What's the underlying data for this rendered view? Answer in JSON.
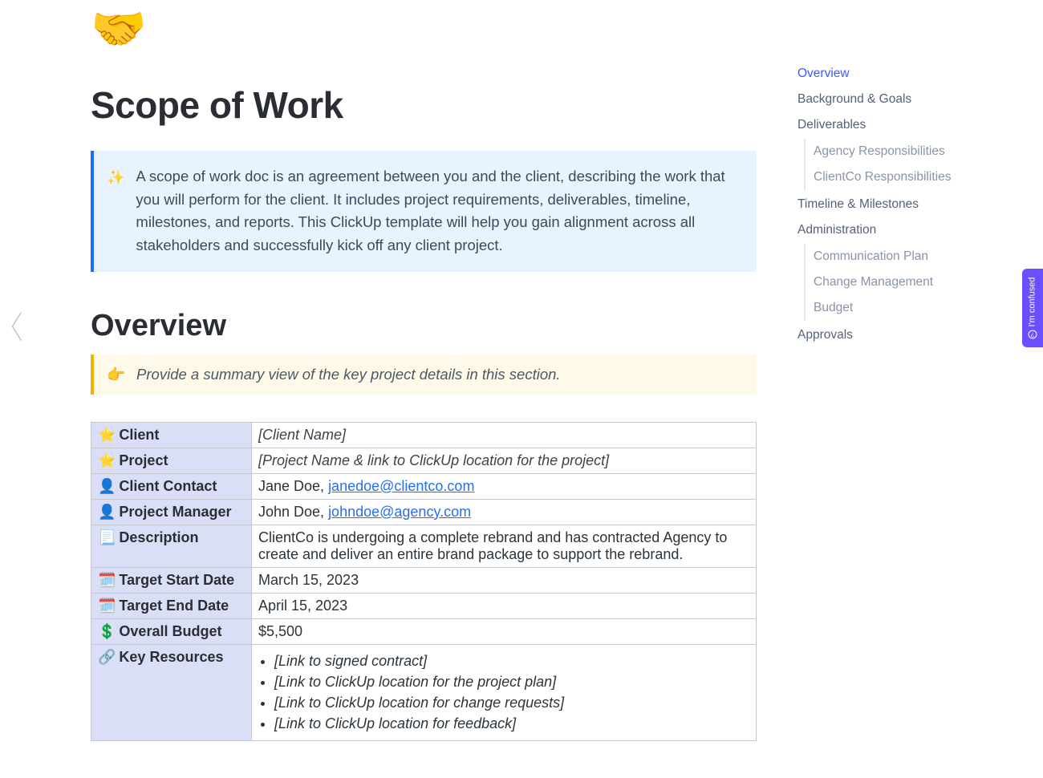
{
  "hero_icon": "🤝",
  "page_title": "Scope of Work",
  "intro_callout": {
    "icon": "✨",
    "text": "A scope of work doc is an agreement between you and the client, describing the work that you will perform for the client. It includes project requirements, deliverables, timeline, milestones, and reports. This ClickUp template will help you gain alignment across all stakeholders and successfully kick off any client project."
  },
  "overview": {
    "heading": "Overview",
    "hint_icon": "👉",
    "hint_text": "Provide a summary view of the key project details in this section."
  },
  "table": {
    "client": {
      "icon": "⭐",
      "label": "Client",
      "value": "[Client Name]"
    },
    "project": {
      "icon": "⭐",
      "label": "Project",
      "value": "[Project Name & link to ClickUp location for the project]"
    },
    "client_contact": {
      "icon": "👤",
      "label": "Client Contact",
      "name": "Jane Doe, ",
      "email": "janedoe@clientco.com"
    },
    "pm": {
      "icon": "👤",
      "label": "Project Manager",
      "name": "John Doe, ",
      "email": "johndoe@agency.com"
    },
    "description": {
      "icon": "📃",
      "label": "Description",
      "value": "ClientCo is undergoing a complete rebrand and has contracted Agency to create and deliver an entire brand package to support the rebrand."
    },
    "start": {
      "icon": "🗓️",
      "label": "Target Start Date",
      "value": "March 15, 2023"
    },
    "end": {
      "icon": "🗓️",
      "label": "Target End Date",
      "value": "April 15, 2023"
    },
    "budget": {
      "icon": "💲",
      "label": "Overall Budget",
      "value": "$5,500"
    },
    "resources": {
      "icon": "🔗",
      "label": "Key Resources",
      "items": [
        "[Link to signed contract]",
        "[Link to ClickUp location for the project plan]",
        "[Link to ClickUp location for change requests]",
        "[Link to ClickUp location for feedback]"
      ]
    }
  },
  "toc": {
    "overview": "Overview",
    "background": "Background & Goals",
    "deliverables": "Deliverables",
    "deliv_sub": {
      "agency": "Agency Responsibilities",
      "client": "ClientCo Responsibilities"
    },
    "timeline": "Timeline & Milestones",
    "admin": "Administration",
    "admin_sub": {
      "comm": "Communication Plan",
      "change": "Change Management",
      "budget": "Budget"
    },
    "approvals": "Approvals"
  },
  "feedback_tab": "I'm confused"
}
